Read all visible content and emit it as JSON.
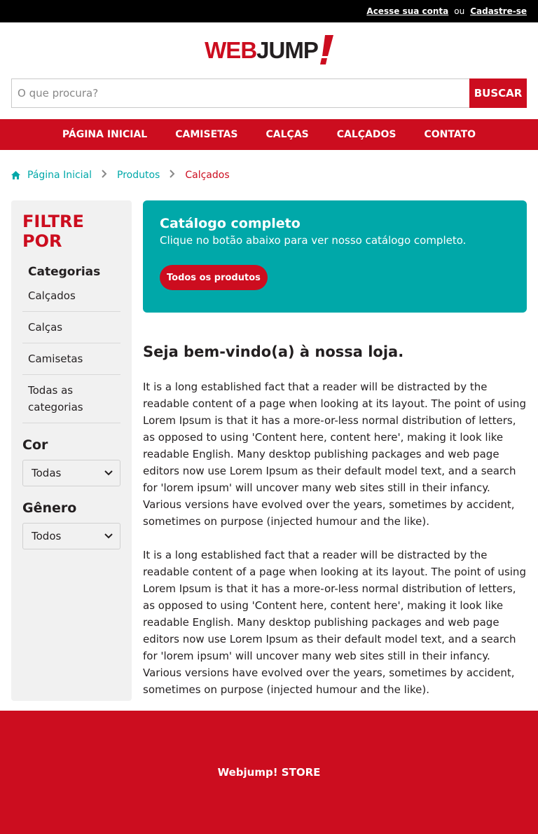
{
  "topbar": {
    "login_link": "Acesse sua conta",
    "separator": "ou",
    "signup_link": "Cadastre-se"
  },
  "logo": {
    "part1": "WEB",
    "part2": "JUMP",
    "colors": {
      "red": "#cc0d1f",
      "dark": "#231f20"
    }
  },
  "search": {
    "placeholder": "O que procura?",
    "button_label": "BUSCAR"
  },
  "nav": {
    "items": [
      "PÁGINA INICIAL",
      "CAMISETAS",
      "CALÇAS",
      "CALÇADOS",
      "CONTATO"
    ]
  },
  "breadcrumb": {
    "home_icon": "home-icon",
    "items": [
      "Página Inicial",
      "Produtos",
      "Calçados"
    ]
  },
  "sidebar": {
    "title": "FILTRE POR",
    "categories_heading": "Categorias",
    "categories": [
      "Calçados",
      "Calças",
      "Camisetas",
      "Todas as categorias"
    ],
    "color_heading": "Cor",
    "color_selected": "Todas",
    "gender_heading": "Gênero",
    "gender_selected": "Todos"
  },
  "banner": {
    "title": "Catálogo completo",
    "subtitle": "Clique no botão abaixo para ver nosso catálogo completo.",
    "button_label": "Todos os produtos"
  },
  "main": {
    "heading": "Seja bem-vindo(a) à nossa loja.",
    "paragraphs": [
      "It is a long established fact that a reader will be distracted by the readable content of a page when looking at its layout. The point of using Lorem Ipsum is that it has a more-or-less normal distribution of letters, as opposed to using 'Content here, content here', making it look like readable English. Many desktop publishing packages and web page editors now use Lorem Ipsum as their default model text, and a search for 'lorem ipsum' will uncover many web sites still in their infancy. Various versions have evolved over the years, sometimes by accident, sometimes on purpose (injected humour and the like).",
      "It is a long established fact that a reader will be distracted by the readable content of a page when looking at its layout. The point of using Lorem Ipsum is that it has a more-or-less normal distribution of letters, as opposed to using 'Content here, content here', making it look like readable English. Many desktop publishing packages and web page editors now use Lorem Ipsum as their default model text, and a search for 'lorem ipsum' will uncover many web sites still in their infancy. Various versions have evolved over the years, sometimes by accident, sometimes on purpose (injected humour and the like)."
    ]
  },
  "footer": {
    "text": "Webjump! STORE"
  },
  "colors": {
    "brand_red": "#cc0d1f",
    "teal": "#00a8a9",
    "topbar": "#000000",
    "sidebar_bg": "#f1f1f1"
  }
}
